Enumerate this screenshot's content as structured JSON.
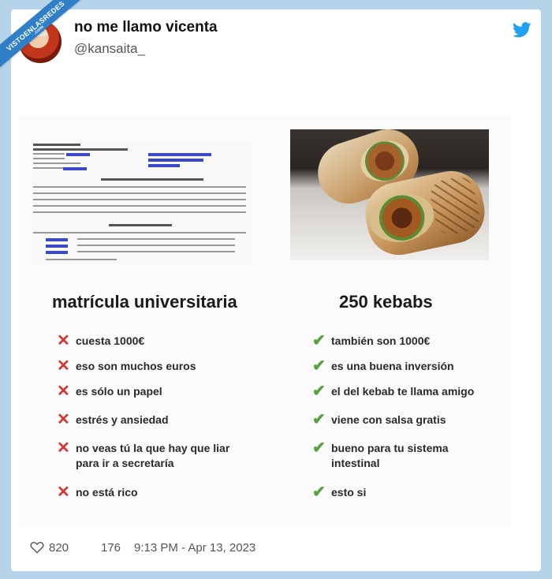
{
  "watermark": {
    "text": "VISTOENLASREDES",
    "sub": ".com"
  },
  "tweet": {
    "display_name": "no me llamo vicenta",
    "handle": "@kansaita_",
    "likes": "820",
    "comments": "176",
    "timestamp": "9:13 PM - Apr 13, 2023"
  },
  "left": {
    "title": "matrícula universitaria",
    "items": [
      {
        "lines": [
          "cuesta 1000€"
        ]
      },
      {
        "lines": [
          "eso son muchos euros"
        ]
      },
      {
        "lines": [
          "es sólo un papel"
        ]
      },
      {
        "lines": [
          "estrés y ansiedad"
        ]
      },
      {
        "lines": [
          "no veas tú la que hay que liar",
          "para ir a secretaría"
        ]
      },
      {
        "lines": [
          "no está rico"
        ]
      }
    ]
  },
  "right": {
    "title": "250 kebabs",
    "items": [
      {
        "lines": [
          "también son 1000€"
        ]
      },
      {
        "lines": [
          "es una buena inversión"
        ]
      },
      {
        "lines": [
          "el del kebab te llama amigo"
        ]
      },
      {
        "lines": [
          "viene con salsa gratis"
        ]
      },
      {
        "lines": [
          "bueno para tu sistema",
          "intestinal"
        ]
      },
      {
        "lines": [
          "esto si"
        ]
      }
    ]
  },
  "icons": {
    "cross": "✕",
    "check": "✔"
  },
  "colors": {
    "cross": "#d6372c",
    "check": "#58a340",
    "twitter_blue": "#1da1f2",
    "frame": "#b5d4ea"
  }
}
